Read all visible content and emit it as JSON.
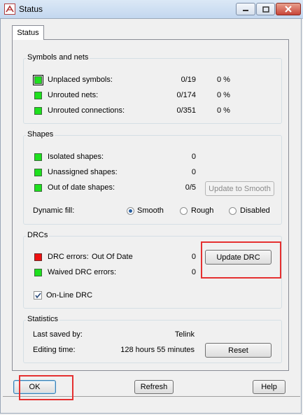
{
  "window": {
    "title": "Status",
    "controls": {
      "minimize": "minimize-icon",
      "maximize": "maximize-icon",
      "close": "close-icon"
    }
  },
  "tabs": [
    {
      "label": "Status",
      "selected": true
    }
  ],
  "symbols_and_nets": {
    "label": "Symbols and nets",
    "rows": [
      {
        "label": "Unplaced symbols:",
        "value": "0/19",
        "percent": "0 %",
        "color": "#1ee01e"
      },
      {
        "label": "Unrouted nets:",
        "value": "0/174",
        "percent": "0 %",
        "color": "#1ee01e"
      },
      {
        "label": "Unrouted connections:",
        "value": "0/351",
        "percent": "0 %",
        "color": "#1ee01e"
      }
    ]
  },
  "shapes": {
    "label": "Shapes",
    "rows": [
      {
        "label": "Isolated shapes:",
        "value": "0",
        "color": "#1ee01e"
      },
      {
        "label": "Unassigned shapes:",
        "value": "0",
        "color": "#1ee01e"
      },
      {
        "label": "Out of date shapes:",
        "value": "0/5",
        "color": "#1ee01e"
      }
    ],
    "update_button": "Update to Smooth",
    "dynamic_fill_label": "Dynamic fill:",
    "dynamic_fill_options": [
      {
        "label": "Smooth",
        "selected": true
      },
      {
        "label": "Rough",
        "selected": false
      },
      {
        "label": "Disabled",
        "selected": false
      }
    ]
  },
  "drcs": {
    "label": "DRCs",
    "rows": [
      {
        "label": "DRC errors:",
        "note": "Out Of Date",
        "value": "0",
        "color": "#ee1111"
      },
      {
        "label": "Waived DRC errors:",
        "value": "0",
        "color": "#1ee01e"
      }
    ],
    "update_button": "Update DRC",
    "online_drc_label": "On-Line DRC",
    "online_drc_checked": true
  },
  "statistics": {
    "label": "Statistics",
    "last_saved_label": "Last saved by:",
    "last_saved_value": "Telink",
    "editing_time_label": "Editing time:",
    "editing_time_value": "128 hours 55 minutes",
    "reset_button": "Reset"
  },
  "footer": {
    "ok_button": "OK",
    "refresh_button": "Refresh",
    "help_button": "Help"
  },
  "highlight_color": "#e53030"
}
